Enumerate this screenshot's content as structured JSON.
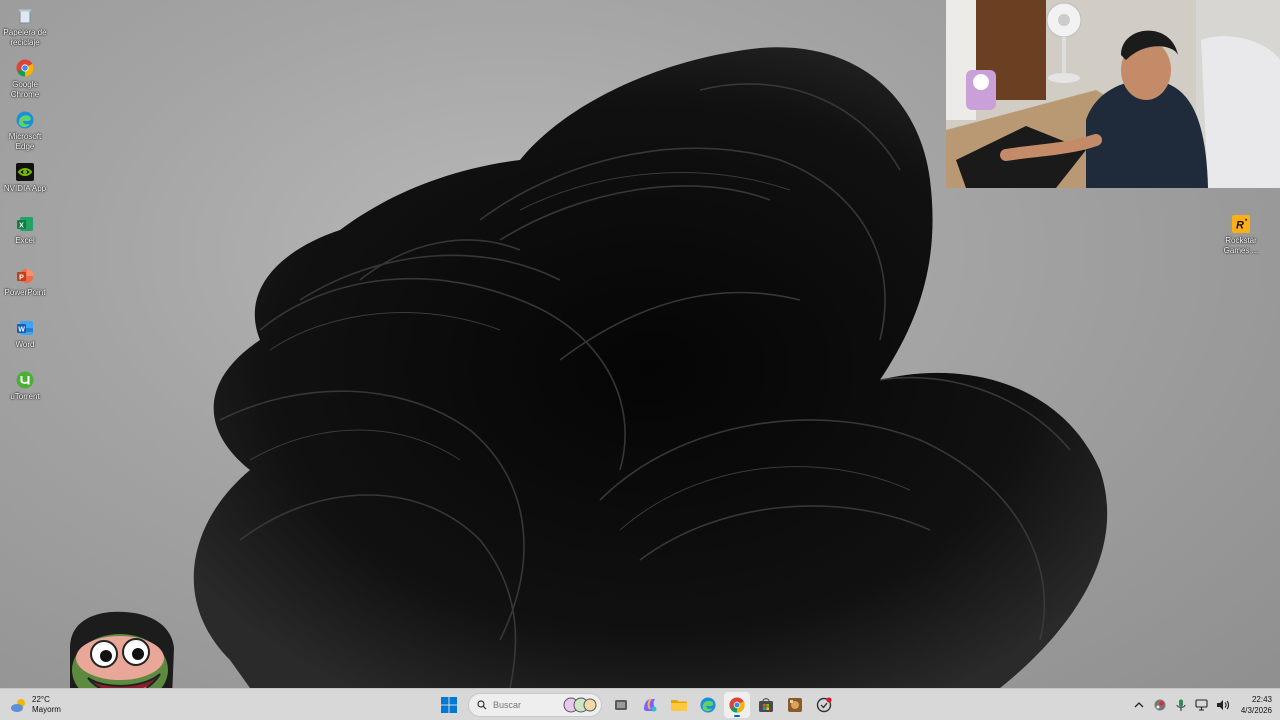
{
  "desktop": {
    "icons": [
      {
        "label": "Papelera de reciclaje",
        "icon": "recycle-bin-icon"
      },
      {
        "label": "Google Chrome",
        "icon": "chrome-icon"
      },
      {
        "label": "Microsoft Edge",
        "icon": "edge-icon"
      },
      {
        "label": "NVIDIA App",
        "icon": "nvidia-icon"
      },
      {
        "label": "Excel",
        "icon": "excel-icon"
      },
      {
        "label": "PowerPoint",
        "icon": "powerpoint-icon"
      },
      {
        "label": "Word",
        "icon": "word-icon"
      },
      {
        "label": "uTorrent",
        "icon": "utorrent-icon"
      }
    ],
    "right_icon": {
      "label": "Rockstar Games ...",
      "icon": "rockstar-games-icon"
    }
  },
  "taskbar": {
    "weather": {
      "temp": "22°C",
      "condition": "Mayorm",
      "icon": "partly-cloudy-icon"
    },
    "search": {
      "placeholder": "Buscar"
    },
    "apps": [
      "windows-start-icon",
      "task-view-icon",
      "copilot-icon",
      "file-explorer-icon",
      "edge-icon",
      "chrome-icon",
      "microsoft-store-icon",
      "game-icon",
      "app-icon"
    ],
    "active_app": "chrome-icon",
    "tray": [
      "chevron-up-icon",
      "steam-icon",
      "microphone-icon",
      "network-icon",
      "volume-icon"
    ],
    "clock": {
      "time": "22:43",
      "date": "4/3/2026"
    }
  },
  "colors": {
    "accent": "#0067c0",
    "taskbar_bg": "#d8d8d8",
    "desktop_bg": "#a4a4a4"
  }
}
